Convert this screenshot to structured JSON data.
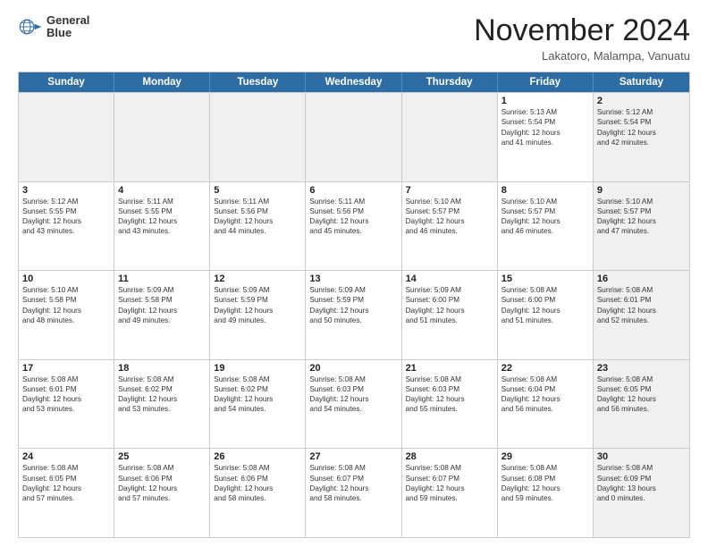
{
  "logo": {
    "line1": "General",
    "line2": "Blue"
  },
  "title": "November 2024",
  "subtitle": "Lakatoro, Malampa, Vanuatu",
  "header": {
    "days": [
      "Sunday",
      "Monday",
      "Tuesday",
      "Wednesday",
      "Thursday",
      "Friday",
      "Saturday"
    ]
  },
  "weeks": [
    {
      "cells": [
        {
          "day": "",
          "info": "",
          "shaded": true
        },
        {
          "day": "",
          "info": "",
          "shaded": true
        },
        {
          "day": "",
          "info": "",
          "shaded": true
        },
        {
          "day": "",
          "info": "",
          "shaded": true
        },
        {
          "day": "",
          "info": "",
          "shaded": true
        },
        {
          "day": "1",
          "info": "Sunrise: 5:13 AM\nSunset: 5:54 PM\nDaylight: 12 hours\nand 41 minutes.",
          "shaded": false
        },
        {
          "day": "2",
          "info": "Sunrise: 5:12 AM\nSunset: 5:54 PM\nDaylight: 12 hours\nand 42 minutes.",
          "shaded": true
        }
      ]
    },
    {
      "cells": [
        {
          "day": "3",
          "info": "Sunrise: 5:12 AM\nSunset: 5:55 PM\nDaylight: 12 hours\nand 43 minutes.",
          "shaded": false
        },
        {
          "day": "4",
          "info": "Sunrise: 5:11 AM\nSunset: 5:55 PM\nDaylight: 12 hours\nand 43 minutes.",
          "shaded": false
        },
        {
          "day": "5",
          "info": "Sunrise: 5:11 AM\nSunset: 5:56 PM\nDaylight: 12 hours\nand 44 minutes.",
          "shaded": false
        },
        {
          "day": "6",
          "info": "Sunrise: 5:11 AM\nSunset: 5:56 PM\nDaylight: 12 hours\nand 45 minutes.",
          "shaded": false
        },
        {
          "day": "7",
          "info": "Sunrise: 5:10 AM\nSunset: 5:57 PM\nDaylight: 12 hours\nand 46 minutes.",
          "shaded": false
        },
        {
          "day": "8",
          "info": "Sunrise: 5:10 AM\nSunset: 5:57 PM\nDaylight: 12 hours\nand 46 minutes.",
          "shaded": false
        },
        {
          "day": "9",
          "info": "Sunrise: 5:10 AM\nSunset: 5:57 PM\nDaylight: 12 hours\nand 47 minutes.",
          "shaded": true
        }
      ]
    },
    {
      "cells": [
        {
          "day": "10",
          "info": "Sunrise: 5:10 AM\nSunset: 5:58 PM\nDaylight: 12 hours\nand 48 minutes.",
          "shaded": false
        },
        {
          "day": "11",
          "info": "Sunrise: 5:09 AM\nSunset: 5:58 PM\nDaylight: 12 hours\nand 49 minutes.",
          "shaded": false
        },
        {
          "day": "12",
          "info": "Sunrise: 5:09 AM\nSunset: 5:59 PM\nDaylight: 12 hours\nand 49 minutes.",
          "shaded": false
        },
        {
          "day": "13",
          "info": "Sunrise: 5:09 AM\nSunset: 5:59 PM\nDaylight: 12 hours\nand 50 minutes.",
          "shaded": false
        },
        {
          "day": "14",
          "info": "Sunrise: 5:09 AM\nSunset: 6:00 PM\nDaylight: 12 hours\nand 51 minutes.",
          "shaded": false
        },
        {
          "day": "15",
          "info": "Sunrise: 5:08 AM\nSunset: 6:00 PM\nDaylight: 12 hours\nand 51 minutes.",
          "shaded": false
        },
        {
          "day": "16",
          "info": "Sunrise: 5:08 AM\nSunset: 6:01 PM\nDaylight: 12 hours\nand 52 minutes.",
          "shaded": true
        }
      ]
    },
    {
      "cells": [
        {
          "day": "17",
          "info": "Sunrise: 5:08 AM\nSunset: 6:01 PM\nDaylight: 12 hours\nand 53 minutes.",
          "shaded": false
        },
        {
          "day": "18",
          "info": "Sunrise: 5:08 AM\nSunset: 6:02 PM\nDaylight: 12 hours\nand 53 minutes.",
          "shaded": false
        },
        {
          "day": "19",
          "info": "Sunrise: 5:08 AM\nSunset: 6:02 PM\nDaylight: 12 hours\nand 54 minutes.",
          "shaded": false
        },
        {
          "day": "20",
          "info": "Sunrise: 5:08 AM\nSunset: 6:03 PM\nDaylight: 12 hours\nand 54 minutes.",
          "shaded": false
        },
        {
          "day": "21",
          "info": "Sunrise: 5:08 AM\nSunset: 6:03 PM\nDaylight: 12 hours\nand 55 minutes.",
          "shaded": false
        },
        {
          "day": "22",
          "info": "Sunrise: 5:08 AM\nSunset: 6:04 PM\nDaylight: 12 hours\nand 56 minutes.",
          "shaded": false
        },
        {
          "day": "23",
          "info": "Sunrise: 5:08 AM\nSunset: 6:05 PM\nDaylight: 12 hours\nand 56 minutes.",
          "shaded": true
        }
      ]
    },
    {
      "cells": [
        {
          "day": "24",
          "info": "Sunrise: 5:08 AM\nSunset: 6:05 PM\nDaylight: 12 hours\nand 57 minutes.",
          "shaded": false
        },
        {
          "day": "25",
          "info": "Sunrise: 5:08 AM\nSunset: 6:06 PM\nDaylight: 12 hours\nand 57 minutes.",
          "shaded": false
        },
        {
          "day": "26",
          "info": "Sunrise: 5:08 AM\nSunset: 6:06 PM\nDaylight: 12 hours\nand 58 minutes.",
          "shaded": false
        },
        {
          "day": "27",
          "info": "Sunrise: 5:08 AM\nSunset: 6:07 PM\nDaylight: 12 hours\nand 58 minutes.",
          "shaded": false
        },
        {
          "day": "28",
          "info": "Sunrise: 5:08 AM\nSunset: 6:07 PM\nDaylight: 12 hours\nand 59 minutes.",
          "shaded": false
        },
        {
          "day": "29",
          "info": "Sunrise: 5:08 AM\nSunset: 6:08 PM\nDaylight: 12 hours\nand 59 minutes.",
          "shaded": false
        },
        {
          "day": "30",
          "info": "Sunrise: 5:08 AM\nSunset: 6:09 PM\nDaylight: 13 hours\nand 0 minutes.",
          "shaded": true
        }
      ]
    }
  ]
}
